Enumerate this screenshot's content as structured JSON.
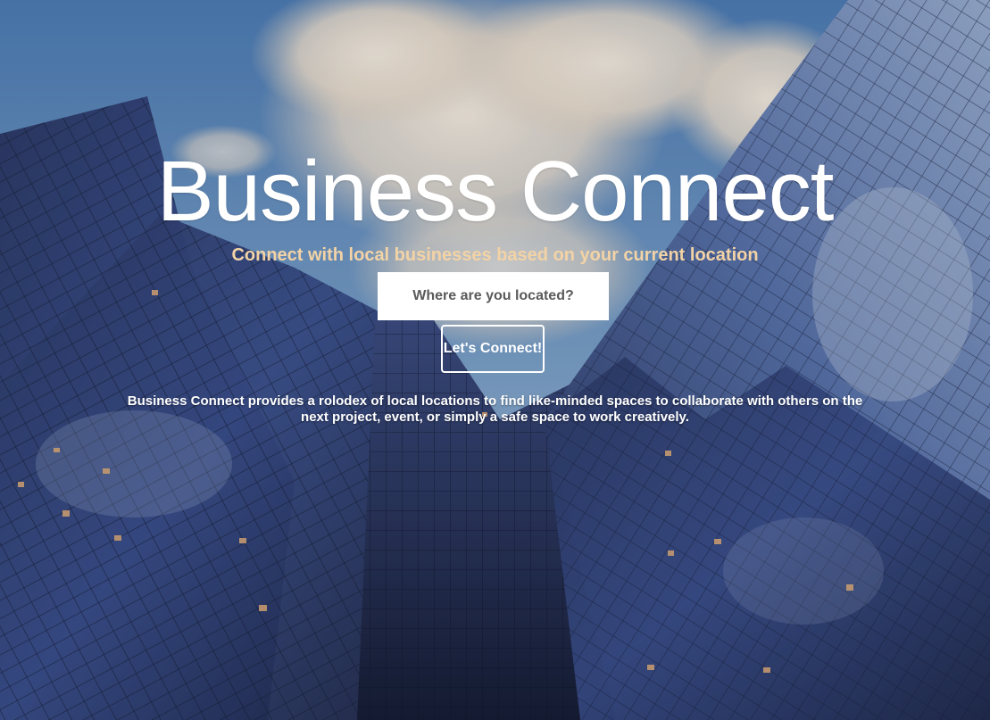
{
  "hero": {
    "title": "Business Connect",
    "subtitle": "Connect with local businesses based on your current location",
    "search": {
      "placeholder": "Where are you located?",
      "value": ""
    },
    "cta_label": "Let's Connect!",
    "description": "Business Connect provides a rolodex of local locations to find like-minded spaces to collaborate with others on the next project, event, or simply a safe space to work creatively."
  },
  "colors": {
    "subtitle": "#f3d3a6",
    "title": "#ffffff",
    "input_background": "#ffffff",
    "button_border": "#ffffff"
  }
}
